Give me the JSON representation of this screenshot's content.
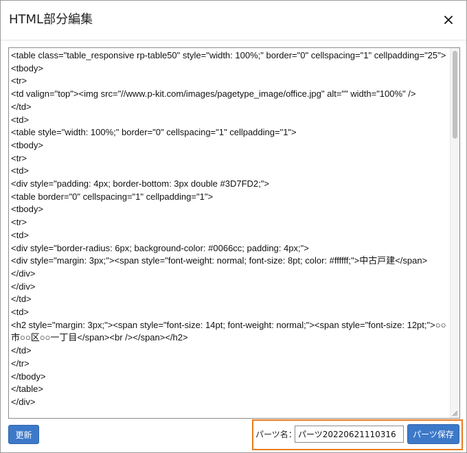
{
  "dialog": {
    "title": "HTML部分編集",
    "close_label": "×"
  },
  "editor": {
    "lines": [
      "<table class=\"table_responsive rp-table50\" style=\"width: 100%;\" border=\"0\" cellspacing=\"1\" cellpadding=\"25\">",
      "<tbody>",
      "<tr>",
      "<td valign=\"top\"><img src=\"//www.p-kit.com/images/pagetype_image/office.jpg\" alt=\"\" width=\"100%\" />",
      "</td>",
      "<td>",
      "<table style=\"width: 100%;\" border=\"0\" cellspacing=\"1\" cellpadding=\"1\">",
      "<tbody>",
      "<tr>",
      "<td>",
      "<div style=\"padding: 4px; border-bottom: 3px double #3D7FD2;\">",
      "<table border=\"0\" cellspacing=\"1\" cellpadding=\"1\">",
      "<tbody>",
      "<tr>",
      "<td>",
      "<div style=\"border-radius: 6px; background-color: #0066cc; padding: 4px;\">",
      "<div style=\"margin: 3px;\"><span style=\"font-weight: normal; font-size: 8pt; color: #ffffff;\">中古戸建</span>",
      "</div>",
      "</div>",
      "</td>",
      "<td>",
      "<h2 style=\"margin: 3px;\"><span style=\"font-size: 14pt; font-weight: normal;\"><span style=\"font-size: 12pt;\">○○市○○区○○一丁目</span><br /></span></h2>",
      "</td>",
      "</tr>",
      "</tbody>",
      "</table>",
      "</div>"
    ]
  },
  "footer": {
    "update_label": "更新",
    "parts_name_label": "パーツ名：",
    "parts_name_value": "パーツ20220621110316",
    "save_label": "パーツ保存"
  },
  "colors": {
    "button_blue": "#3d79c9",
    "highlight_orange": "#ea7a1e"
  }
}
